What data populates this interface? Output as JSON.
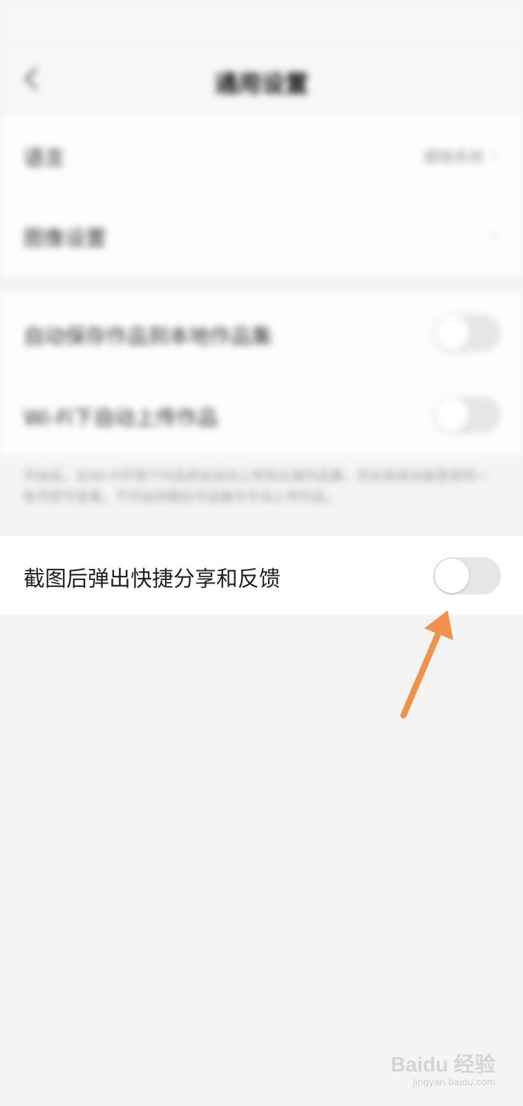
{
  "status_bar": {
    "left_text": "",
    "right_text": ""
  },
  "nav": {
    "title": "通用设置",
    "back_icon": "chevron-left-icon"
  },
  "settings": {
    "group1": [
      {
        "label": "语言",
        "value": "跟随系统",
        "chevron": "›"
      },
      {
        "label": "图像设置",
        "value": "",
        "chevron": "›"
      }
    ],
    "group2": [
      {
        "label": "自动保存作品到本地作品集",
        "toggle_on": false
      },
      {
        "label": "Wi-Fi下自动上传作品",
        "toggle_on": false
      }
    ],
    "group2_description": "开启后，在Wi-Fi环境下作品将会自动上传到云端作品集，您在其他设备登录同一账号即可查看，不开启则需在作品集中手动上传作品。",
    "highlighted_row": {
      "label": "截图后弹出快捷分享和反馈",
      "toggle_on": false
    }
  },
  "annotation": {
    "arrow_color": "#F0924A",
    "arrow_icon": "arrow-up-icon"
  },
  "watermark": {
    "logo": "Baidu 经验",
    "url": "jingyan.baidu.com"
  }
}
